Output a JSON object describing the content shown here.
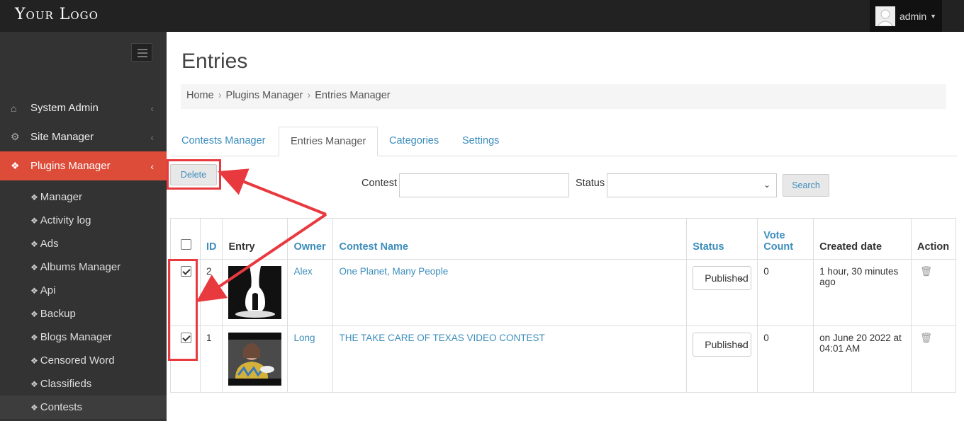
{
  "header": {
    "logo": "Your Logo",
    "user_name": "admin"
  },
  "sidebar": {
    "items": [
      {
        "label": "System Admin",
        "icon": "home-icon"
      },
      {
        "label": "Site Manager",
        "icon": "gears-icon"
      },
      {
        "label": "Plugins Manager",
        "icon": "plug-icon"
      }
    ],
    "subitems": [
      {
        "label": "Manager"
      },
      {
        "label": "Activity log"
      },
      {
        "label": "Ads"
      },
      {
        "label": "Albums Manager"
      },
      {
        "label": "Api"
      },
      {
        "label": "Backup"
      },
      {
        "label": "Blogs Manager"
      },
      {
        "label": "Censored Word"
      },
      {
        "label": "Classifieds"
      },
      {
        "label": "Contests"
      }
    ]
  },
  "page": {
    "title": "Entries"
  },
  "breadcrumb": [
    "Home",
    "Plugins Manager",
    "Entries Manager"
  ],
  "tabs": [
    "Contests Manager",
    "Entries Manager",
    "Categories",
    "Settings"
  ],
  "toolbar": {
    "delete_label": "Delete",
    "search_label": "Search"
  },
  "filters": {
    "contest_label": "Contest",
    "contest_value": "",
    "status_label": "Status",
    "status_value": ""
  },
  "table": {
    "headers": {
      "id": "ID",
      "entry": "Entry",
      "owner": "Owner",
      "contest": "Contest Name",
      "status": "Status",
      "vote_count": "Vote Count",
      "created": "Created date",
      "action": "Action"
    },
    "rows": [
      {
        "checked": true,
        "id": "2",
        "owner": "Alex",
        "contest": "One Planet, Many People",
        "status": "Published",
        "votes": "0",
        "created": "1 hour, 30 minutes ago"
      },
      {
        "checked": true,
        "id": "1",
        "owner": "Long",
        "contest": "THE TAKE CARE OF TEXAS VIDEO CONTEST",
        "status": "Published",
        "votes": "0",
        "created": "on June 20 2022 at 04:01 AM"
      }
    ]
  },
  "colors": {
    "accent": "#3c8dbc",
    "active_menu": "#dd4b39",
    "highlight": "#e8393f"
  }
}
